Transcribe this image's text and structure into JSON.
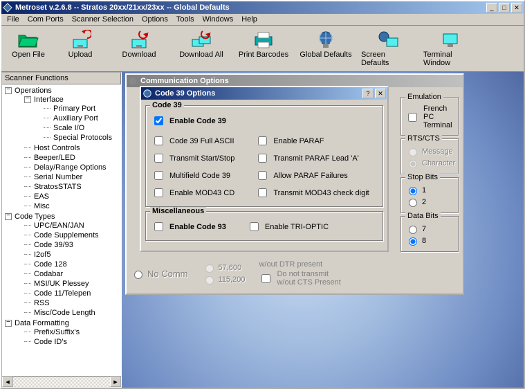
{
  "window": {
    "title": "Metroset v.2.6.8 -- Stratos 20xx/21xx/23xx -- Global Defaults"
  },
  "menu": {
    "i0": "File",
    "i1": "Com Ports",
    "i2": "Scanner Selection",
    "i3": "Options",
    "i4": "Tools",
    "i5": "Windows",
    "i6": "Help"
  },
  "toolbar": {
    "t0": "Open File",
    "t1": "Upload",
    "t2": "Download",
    "t3": "Download All",
    "t4": "Print Barcodes",
    "t5": "Global Defaults",
    "t6": "Screen Defaults",
    "t7": "Terminal Window"
  },
  "sidebar": {
    "header": "Scanner Functions",
    "tree": {
      "ops": "Operations",
      "iface": "Interface",
      "pp": "Primary Port",
      "ap": "Auxiliary Port",
      "sio": "Scale I/O",
      "sp": "Special Protocols",
      "hc": "Host Controls",
      "bl": "Beeper/LED",
      "dro": "Delay/Range Options",
      "sn": "Serial Number",
      "ss": "StratosSTATS",
      "eas": "EAS",
      "misc": "Misc",
      "ct": "Code Types",
      "upc": "UPC/EAN/JAN",
      "cs": "Code Supplements",
      "c39": "Code 39/93",
      "i25": "I2of5",
      "c128": "Code 128",
      "cdb": "Codabar",
      "msi": "MSI/UK Plessey",
      "c11": "Code 11/Telepen",
      "rss": "RSS",
      "mcl": "Misc/Code Length",
      "df": "Data Formatting",
      "ps": "Prefix/Suffix's",
      "cid": "Code ID's"
    }
  },
  "comm": {
    "title": "Communication Options",
    "emu": {
      "title": "Emulation",
      "fr": "French PC Terminal"
    },
    "rtscts": {
      "title": "RTS/CTS",
      "msg": "Message",
      "chr": "Character"
    },
    "stopbits": {
      "title": "Stop Bits",
      "b1": "1",
      "b2": "2"
    },
    "databits": {
      "title": "Data Bits",
      "b7": "7",
      "b8": "8"
    },
    "lower": {
      "nocom": "No Comm",
      "b57": "57,600",
      "b115": "115,200",
      "dtr": "w/out DTR present",
      "cts1": "Do not transmit",
      "cts2": "w/out CTS Present"
    }
  },
  "c39": {
    "title": "Code 39 Options",
    "g1": "Code 39",
    "enable": "Enable Code 39",
    "o0": "Code 39 Full ASCII",
    "o1": "Enable PARAF",
    "o2": "Transmit Start/Stop",
    "o3": "Transmit PARAF Lead 'A'",
    "o4": "Multifield Code 39",
    "o5": "Allow PARAF Failures",
    "o6": "Enable MOD43 CD",
    "o7": "Transmit MOD43 check digit",
    "g2": "Miscellaneous",
    "m0": "Enable Code 93",
    "m1": "Enable TRI-OPTIC"
  }
}
